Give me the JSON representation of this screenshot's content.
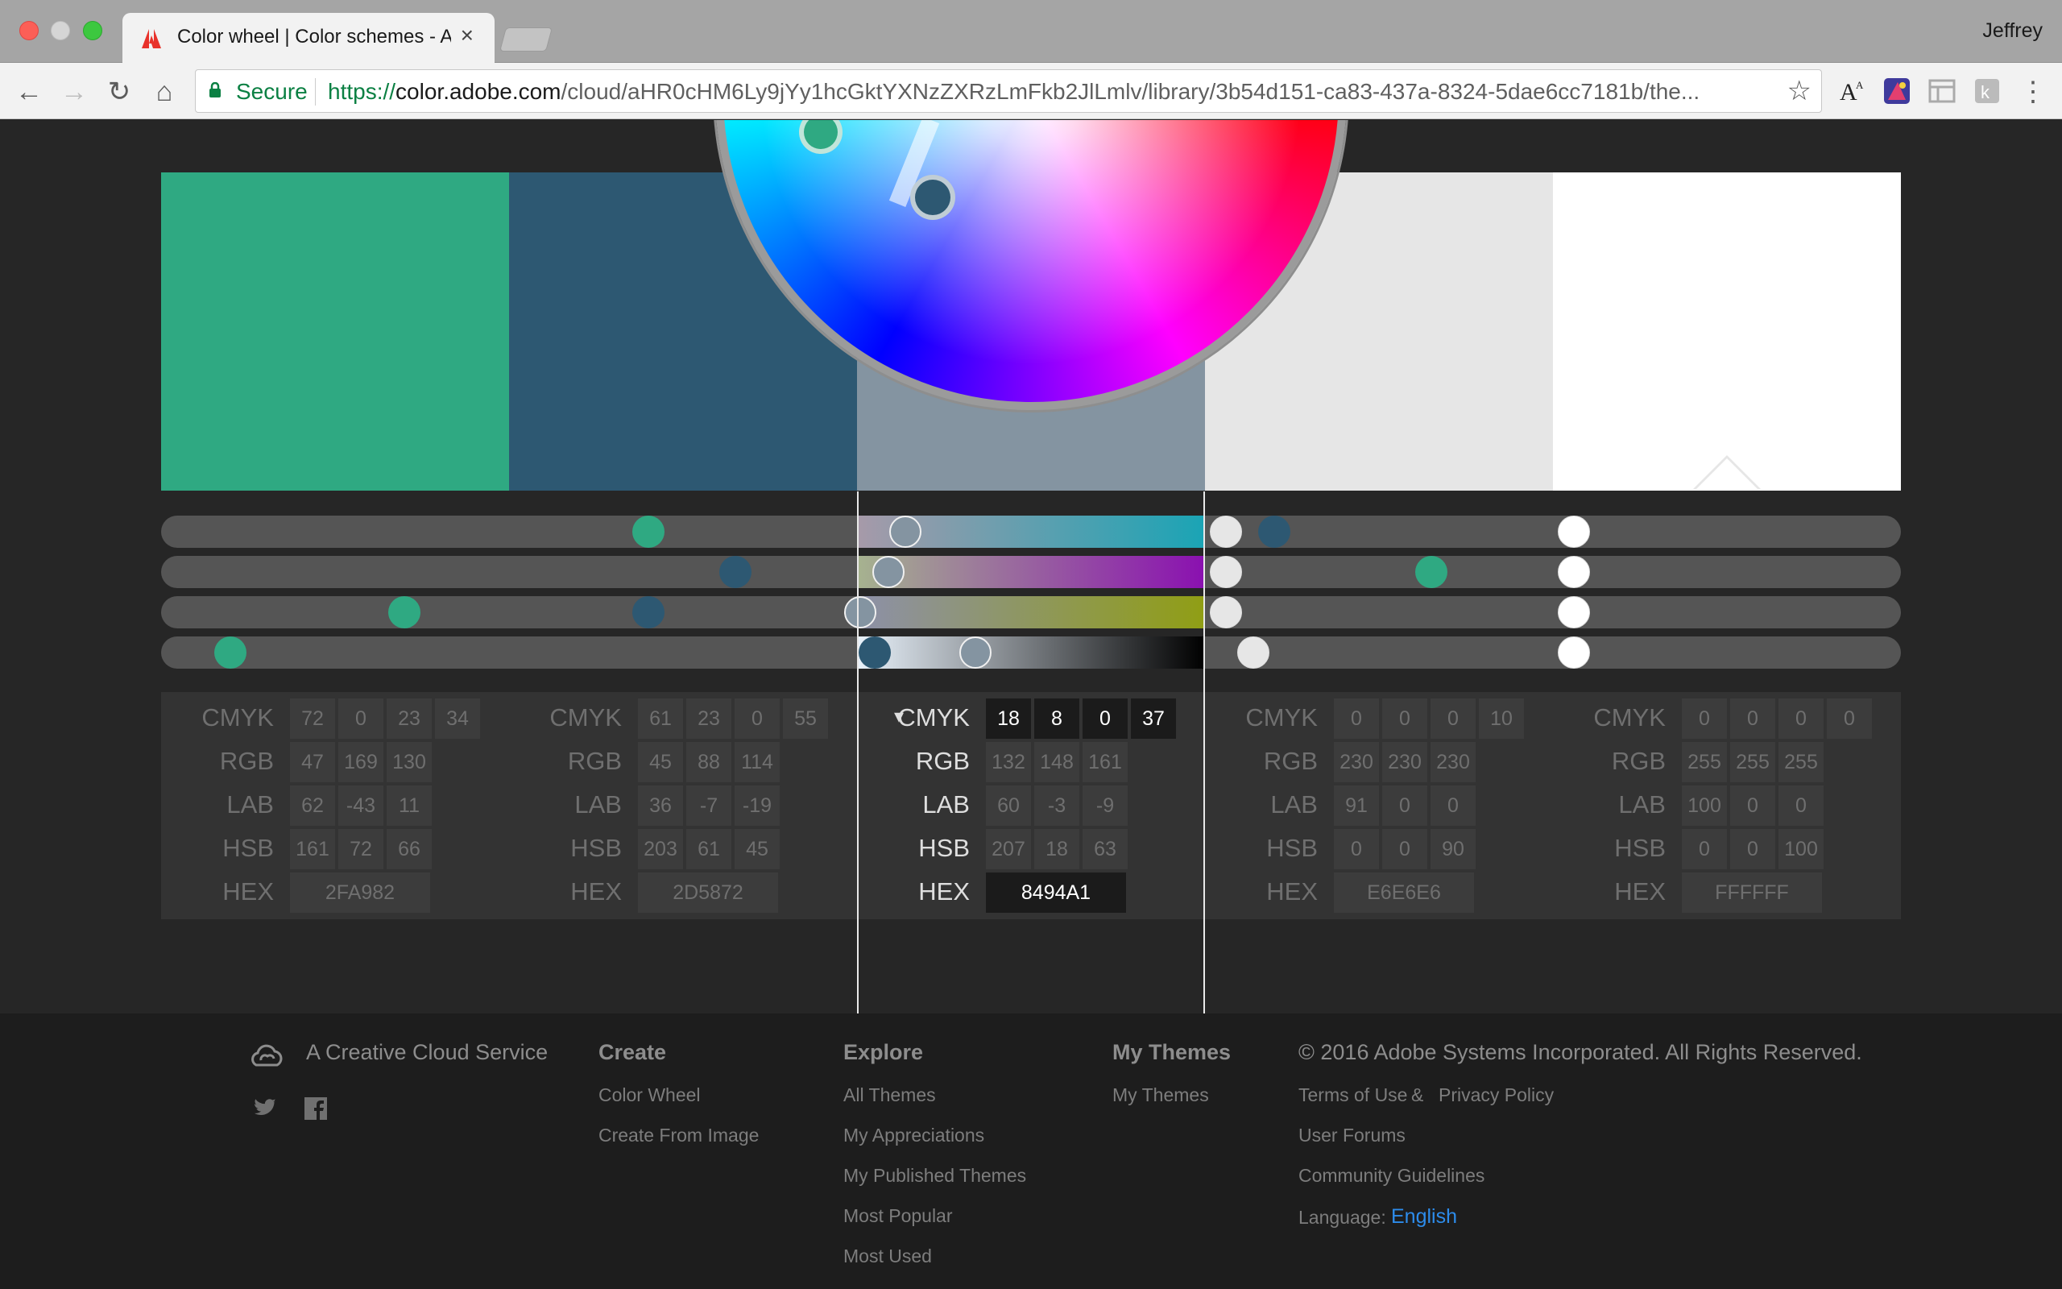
{
  "browser": {
    "tab_title": "Color wheel | Color schemes - Adobe Color CC",
    "tab_close": "×",
    "profile_name": "Jeffrey",
    "secure_label": "Secure",
    "url_scheme": "https://",
    "url_host": "color.adobe.com",
    "url_path": "/cloud/aHR0cHM6Ly9jYy1hcGktYXNzZXRzLmFkb2JlLmlv/library/3b54d151-ca83-437a-8324-5dae6cc7181b/the...",
    "star_icon": "☆",
    "back_icon": "←",
    "forward_icon": "→",
    "reload_icon": "↻",
    "home_icon": "⌂",
    "menu_icon": "⋮"
  },
  "swatches": [
    {
      "hex": "#2FA982"
    },
    {
      "hex": "#2D5872"
    },
    {
      "hex": "#8494A1"
    },
    {
      "hex": "#E6E6E6"
    },
    {
      "hex": "#FFFFFF"
    }
  ],
  "slider_levels": [
    [
      0.28,
      0.73,
      0.14,
      0.04
    ],
    [
      0.64,
      0.33,
      0.28,
      0.41
    ],
    [
      0.14,
      0.09,
      0.01,
      0.34
    ],
    [
      0.06,
      0.06,
      0.06,
      0.14
    ],
    [
      0.06,
      0.06,
      0.06,
      0.06
    ]
  ],
  "values": {
    "labels": [
      "CMYK",
      "RGB",
      "LAB",
      "HSB",
      "HEX"
    ],
    "columns": [
      {
        "cmyk": [
          "72",
          "0",
          "23",
          "34"
        ],
        "rgb": [
          "47",
          "169",
          "130"
        ],
        "lab": [
          "62",
          "-43",
          "11"
        ],
        "hsb": [
          "161",
          "72",
          "66"
        ],
        "hex": "2FA982"
      },
      {
        "cmyk": [
          "61",
          "23",
          "0",
          "55"
        ],
        "rgb": [
          "45",
          "88",
          "114"
        ],
        "lab": [
          "36",
          "-7",
          "-19"
        ],
        "hsb": [
          "203",
          "61",
          "45"
        ],
        "hex": "2D5872"
      },
      {
        "cmyk": [
          "18",
          "8",
          "0",
          "37"
        ],
        "rgb": [
          "132",
          "148",
          "161"
        ],
        "lab": [
          "60",
          "-3",
          "-9"
        ],
        "hsb": [
          "207",
          "18",
          "63"
        ],
        "hex": "8494A1"
      },
      {
        "cmyk": [
          "0",
          "0",
          "0",
          "10"
        ],
        "rgb": [
          "230",
          "230",
          "230"
        ],
        "lab": [
          "91",
          "0",
          "0"
        ],
        "hsb": [
          "0",
          "0",
          "90"
        ],
        "hex": "E6E6E6"
      },
      {
        "cmyk": [
          "0",
          "0",
          "0",
          "0"
        ],
        "rgb": [
          "255",
          "255",
          "255"
        ],
        "lab": [
          "100",
          "0",
          "0"
        ],
        "hsb": [
          "0",
          "0",
          "100"
        ],
        "hex": "FFFFFF"
      }
    ],
    "dropdown_icon": "▾"
  },
  "footer": {
    "creative_cloud": "A Creative Cloud Service",
    "create": {
      "heading": "Create",
      "links": [
        "Color Wheel",
        "Create From Image"
      ]
    },
    "explore": {
      "heading": "Explore",
      "links": [
        "All Themes",
        "My Appreciations",
        "My Published Themes",
        "Most Popular",
        "Most Used"
      ]
    },
    "my_themes": {
      "heading": "My Themes",
      "links": [
        "My Themes"
      ]
    },
    "copyright": "© 2016 Adobe Systems Incorporated. All Rights Reserved.",
    "terms": "Terms of Use",
    "amp": "&",
    "privacy": "Privacy Policy",
    "user_forums": "User Forums",
    "community": "Community Guidelines",
    "language_label": "Language:",
    "language_value": "English"
  }
}
